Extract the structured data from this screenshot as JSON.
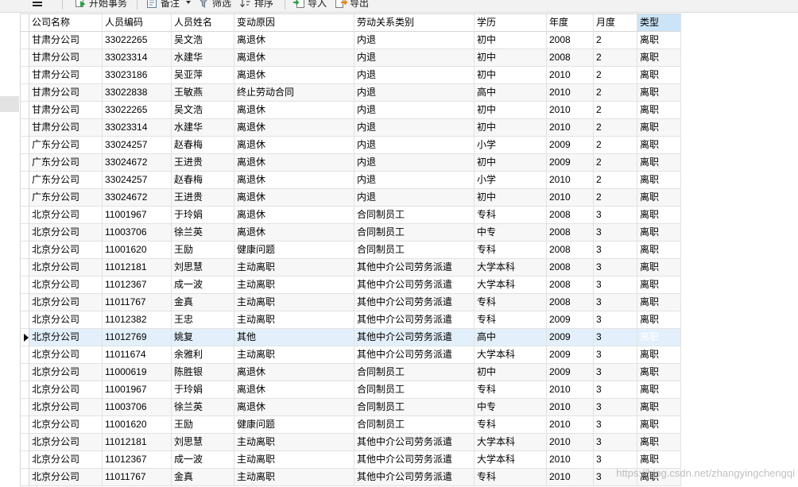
{
  "toolbar": {
    "menu_icon": "menu-icon",
    "begin_transaction": {
      "label": "开始事务",
      "icon": "begin-transaction-icon"
    },
    "note": {
      "label": "备注",
      "icon": "note-icon",
      "dropdown_icon": "chevron-down-icon"
    },
    "filter": {
      "label": "筛选",
      "icon": "filter-icon"
    },
    "sort": {
      "label": "排序",
      "icon": "sort-icon"
    },
    "import": {
      "label": "导入",
      "icon": "import-icon"
    },
    "export": {
      "label": "导出",
      "icon": "export-icon"
    }
  },
  "grid": {
    "columns": [
      "公司名称",
      "人员编码",
      "人员姓名",
      "变动原因",
      "劳动关系类别",
      "学历",
      "年度",
      "月度",
      "类型"
    ],
    "current_cell": {
      "row": 18,
      "column": 9
    },
    "rows": [
      [
        "甘肃分公司",
        "33022265",
        "吴文浩",
        "离退休",
        "内退",
        "初中",
        "2008",
        "2",
        "离职"
      ],
      [
        "甘肃分公司",
        "33023314",
        "水建华",
        "离退休",
        "内退",
        "初中",
        "2008",
        "2",
        "离职"
      ],
      [
        "甘肃分公司",
        "33023186",
        "吴亚萍",
        "离退休",
        "内退",
        "初中",
        "2010",
        "2",
        "离职"
      ],
      [
        "甘肃分公司",
        "33022838",
        "王敏燕",
        "终止劳动合同",
        "内退",
        "高中",
        "2010",
        "2",
        "离职"
      ],
      [
        "甘肃分公司",
        "33022265",
        "吴文浩",
        "离退休",
        "内退",
        "初中",
        "2010",
        "2",
        "离职"
      ],
      [
        "甘肃分公司",
        "33023314",
        "水建华",
        "离退休",
        "内退",
        "初中",
        "2010",
        "2",
        "离职"
      ],
      [
        "广东分公司",
        "33024257",
        "赵春梅",
        "离退休",
        "内退",
        "小学",
        "2009",
        "2",
        "离职"
      ],
      [
        "广东分公司",
        "33024672",
        "王进贵",
        "离退休",
        "内退",
        "初中",
        "2009",
        "2",
        "离职"
      ],
      [
        "广东分公司",
        "33024257",
        "赵春梅",
        "离退休",
        "内退",
        "小学",
        "2010",
        "2",
        "离职"
      ],
      [
        "广东分公司",
        "33024672",
        "王进贵",
        "离退休",
        "内退",
        "初中",
        "2010",
        "2",
        "离职"
      ],
      [
        "北京分公司",
        "11001967",
        "于玲娟",
        "离退休",
        "合同制员工",
        "专科",
        "2008",
        "3",
        "离职"
      ],
      [
        "北京分公司",
        "11003706",
        "徐兰英",
        "离退休",
        "合同制员工",
        "中专",
        "2008",
        "3",
        "离职"
      ],
      [
        "北京分公司",
        "11001620",
        "王励",
        "健康问题",
        "合同制员工",
        "专科",
        "2008",
        "3",
        "离职"
      ],
      [
        "北京分公司",
        "11012181",
        "刘思慧",
        "主动离职",
        "其他中介公司劳务派遣",
        "大学本科",
        "2008",
        "3",
        "离职"
      ],
      [
        "北京分公司",
        "11012367",
        "成一波",
        "主动离职",
        "其他中介公司劳务派遣",
        "大学本科",
        "2008",
        "3",
        "离职"
      ],
      [
        "北京分公司",
        "11011767",
        "金真",
        "主动离职",
        "其他中介公司劳务派遣",
        "专科",
        "2008",
        "3",
        "离职"
      ],
      [
        "北京分公司",
        "11012382",
        "王忠",
        "主动离职",
        "其他中介公司劳务派遣",
        "专科",
        "2009",
        "3",
        "离职"
      ],
      [
        "北京分公司",
        "11012769",
        "姚复",
        "其他",
        "其他中介公司劳务派遣",
        "高中",
        "2009",
        "3",
        "离职"
      ],
      [
        "北京分公司",
        "11011674",
        "余雅利",
        "主动离职",
        "其他中介公司劳务派遣",
        "大学本科",
        "2009",
        "3",
        "离职"
      ],
      [
        "北京分公司",
        "11000619",
        "陈胜银",
        "离退休",
        "合同制员工",
        "初中",
        "2009",
        "3",
        "离职"
      ],
      [
        "北京分公司",
        "11001967",
        "于玲娟",
        "离退休",
        "合同制员工",
        "专科",
        "2010",
        "3",
        "离职"
      ],
      [
        "北京分公司",
        "11003706",
        "徐兰英",
        "离退休",
        "合同制员工",
        "中专",
        "2010",
        "3",
        "离职"
      ],
      [
        "北京分公司",
        "11001620",
        "王励",
        "健康问题",
        "合同制员工",
        "专科",
        "2010",
        "3",
        "离职"
      ],
      [
        "北京分公司",
        "11012181",
        "刘思慧",
        "主动离职",
        "其他中介公司劳务派遣",
        "大学本科",
        "2010",
        "3",
        "离职"
      ],
      [
        "北京分公司",
        "11012367",
        "成一波",
        "主动离职",
        "其他中介公司劳务派遣",
        "大学本科",
        "2010",
        "3",
        "离职"
      ],
      [
        "北京分公司",
        "11011767",
        "金真",
        "主动离职",
        "其他中介公司劳务派遣",
        "专科",
        "2010",
        "3",
        "离职"
      ]
    ]
  },
  "watermark": "https://blog.csdn.net/zhangyingchengqi",
  "colors": {
    "selected_cell": "#0078D7",
    "selected_column_header": "#CCE4F7",
    "current_row": "#E3F0FB"
  }
}
